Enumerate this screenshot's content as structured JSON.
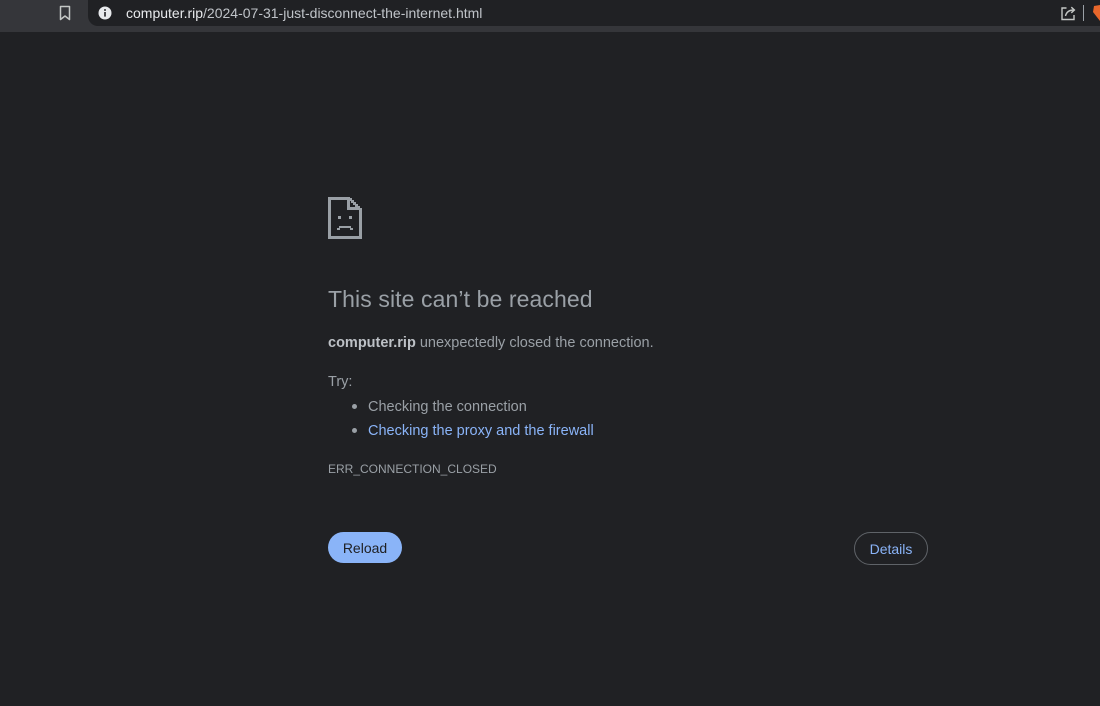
{
  "toolbar": {
    "url_host": "computer.rip",
    "url_path": "/2024-07-31-just-disconnect-the-internet.html",
    "bookmark_icon": "bookmark-icon",
    "site_info_icon": "info-icon",
    "share_icon": "share-icon"
  },
  "error_page": {
    "icon": "sad-document-icon",
    "title": "This site can’t be reached",
    "message_host": "computer.rip",
    "message_rest": " unexpectedly closed the connection.",
    "try_label": "Try:",
    "suggestions": [
      {
        "text": "Checking the connection"
      },
      {
        "text": "Checking the proxy and the firewall"
      }
    ],
    "error_code": "ERR_CONNECTION_CLOSED",
    "reload_label": "Reload",
    "details_label": "Details"
  },
  "colors": {
    "page_background": "#202124",
    "toolbar_background": "#35363a",
    "text_secondary": "#9aa0a6",
    "link": "#8ab4f8",
    "primary_button": "#8ab4f8",
    "extension_accent": "#e8672b"
  }
}
